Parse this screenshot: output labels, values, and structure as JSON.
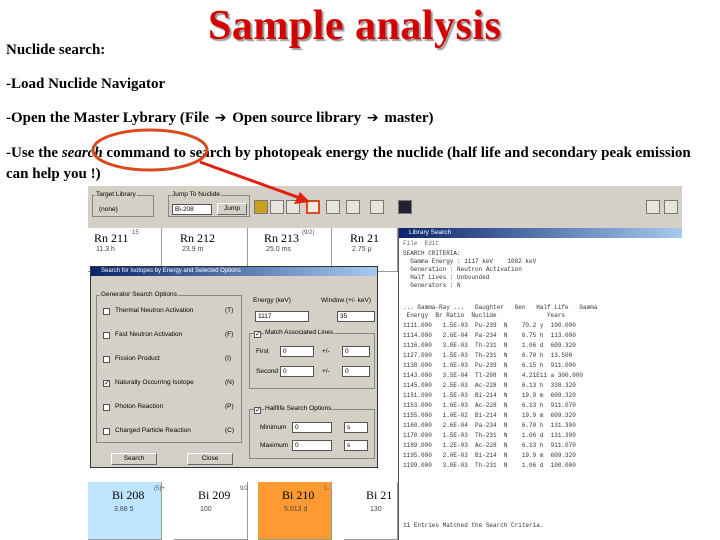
{
  "slide": {
    "title": "Sample analysis",
    "bullets": {
      "b0": "Nuclide search:",
      "b1_pre": "-Load Nuclide Navigator",
      "b2_pre": "-Open the Master Lybrary (File",
      "b2_mid": "Open source library",
      "b2_end": "master)",
      "b3_pre": "-Use the",
      "b3_ital": "search",
      "b3_post": "command to search by photopeak energy the nuclide (half life and secondary peak emission can help you !)"
    },
    "colors": {
      "title": "#d40000",
      "highlight_circle": "#d94a1e",
      "arrow": "#e02010"
    }
  },
  "screenshot": {
    "toolbar": {
      "target_library_label": "Target Library",
      "target_library_value": "(none)",
      "jump_label": "Jump To Nuclide",
      "jump_value": "Bi-208",
      "jump_button": "Jump"
    },
    "chart_top_cells": [
      {
        "name": "Rn 211",
        "sub": "11.3 h",
        "sup": "15"
      },
      {
        "name": "Rn 212",
        "sub": "23.9 m",
        "sup": ""
      },
      {
        "name": "Rn 213",
        "sub": "25.0 ms",
        "sup": "(9/2)"
      },
      {
        "name": "Rn 21",
        "sub": "2.75 μ",
        "sup": ""
      }
    ],
    "chart_bottom_cells": [
      {
        "name": "Bi 208",
        "sub": "3.68 5",
        "sup": "(5)+",
        "fill": "#bfe6ff"
      },
      {
        "name": "Bi 209",
        "sub": "100",
        "sup": "9/2",
        "fill": "#ffffff"
      },
      {
        "name": "Bi 210",
        "sub": "5.013 d",
        "sup": "1-",
        "fill": "#ff9a33"
      },
      {
        "name": "Bi 21",
        "sub": "130",
        "sup": "",
        "fill": "#ffffff"
      }
    ],
    "dialog": {
      "title": "Search for Isotopes by Energy and Selected Options",
      "generator_group": "Generator Search Options",
      "options": [
        {
          "label": "Thermal Neutron Activation",
          "code": "(T)",
          "checked": false
        },
        {
          "label": "Fast Neutron Activation",
          "code": "(F)",
          "checked": false
        },
        {
          "label": "Fission Product",
          "code": "(I)",
          "checked": false
        },
        {
          "label": "Naturally Occurring Isotope",
          "code": "(N)",
          "checked": true
        },
        {
          "label": "Photon Reaction",
          "code": "(P)",
          "checked": false
        },
        {
          "label": "Charged Particle Reaction",
          "code": "(C)",
          "checked": false
        }
      ],
      "energy_label": "Energy (keV)",
      "energy_value": "1117",
      "window_label": "Window (+/- keV)",
      "window_value": "35",
      "match_group": "Match Associated Lines",
      "first_label": "First",
      "first_value": "0",
      "second_label": "Second",
      "second_value": "0",
      "pm": "+/-",
      "pm_value1": "0",
      "pm_value2": "0",
      "halflife_group": "Halflife Search Options",
      "minimum_label": "Minimum",
      "minimum_value": "0",
      "maximum_label": "Maximum",
      "maximum_value": "0",
      "unit": "s",
      "search_button": "Search",
      "close_button": "Close"
    },
    "library": {
      "title": "Library Search",
      "menu": "File  Edit",
      "header_lines": [
        "SEARCH CRITERIA:",
        "  Gamma Energy : 1117 keV    1082 keV",
        "  Generation : Neutron Activation",
        "  Half Lives : Unbounded",
        "  Generators : N"
      ],
      "table_header": "... Gamma-Ray ...   Daughter   Gen   Half Life   Gamma",
      "table_sub": " Energy  Br Ratio  Nuclide              Years",
      "rows": [
        "1111.000   1.5E-03  Pu-239  N    70.2 y  100.000",
        "1114.000   2.6E-04  Pa-234  N    6.75 h  113.000",
        "1116.000   3.0E-03  Th-231  N    1.06 d  609.320",
        "1127.000   1.5E-03  Th-231  N    6.70 h  13.500",
        "1138.000   1.0E-03  Pu-239  N    6.15 h  911.000",
        "1143.000   3.5E-04  Tl-208  N    4.21E11 a 300.000",
        "1145.000   2.5E-03  Ac-228  N    6.13 h  338.320",
        "1151.000   1.5E-03  Bi-214  N    19.9 m  609.320",
        "1153.000   1.6E-03  Ac-228  N    6.13 h  911.070",
        "1155.000   1.0E-02  Bi-214  N    19.9 m  609.320",
        "1160.000   2.6E-04  Pa-234  N    6.70 h  131.300",
        "1170.000   1.5E-03  Th-231  N    1.06 d  131.300",
        "1189.000   1.2E-03  Ac-228  N    6.13 h  911.070",
        "1195.000   2.0E-03  Bi-214  N    19.9 m  609.320",
        "1199.000   3.0E-03  Th-231  N    1.06 d  100.000"
      ],
      "footer": "11 Entries Matched the Search Criteria."
    }
  }
}
